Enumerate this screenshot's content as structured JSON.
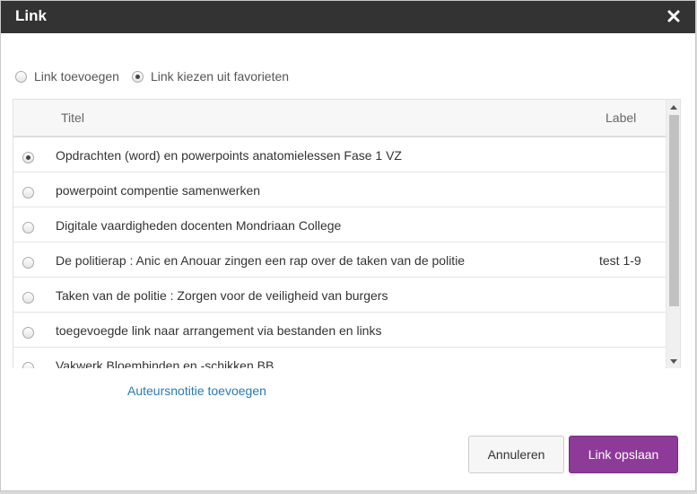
{
  "dialog": {
    "title": "Link",
    "close_icon": "close-icon"
  },
  "mode": {
    "options": [
      {
        "label": "Link toevoegen",
        "checked": false
      },
      {
        "label": "Link kiezen uit favorieten",
        "checked": true
      }
    ]
  },
  "table": {
    "headers": {
      "title": "Titel",
      "label": "Label"
    },
    "rows": [
      {
        "title": "Opdrachten (word) en powerpoints anatomielessen Fase 1 VZ",
        "label": "",
        "selected": true
      },
      {
        "title": "powerpoint compentie samenwerken",
        "label": "",
        "selected": false
      },
      {
        "title": "Digitale vaardigheden docenten Mondriaan College",
        "label": "",
        "selected": false
      },
      {
        "title": "De politierap : Anic en Anouar zingen een rap over de taken van de politie",
        "label": "test 1-9",
        "selected": false
      },
      {
        "title": "Taken van de politie : Zorgen voor de veiligheid van burgers",
        "label": "",
        "selected": false
      },
      {
        "title": "toegevoegde link naar arrangement via bestanden en links",
        "label": "",
        "selected": false
      },
      {
        "title": "Vakwerk Bloembinden en -schikken BB",
        "label": "",
        "selected": false
      }
    ]
  },
  "author_note_link": "Auteursnotitie toevoegen",
  "buttons": {
    "cancel": "Annuleren",
    "save": "Link opslaan"
  },
  "colors": {
    "titlebar": "#333333",
    "accent": "#8e3a98",
    "link": "#2a7ab0"
  }
}
